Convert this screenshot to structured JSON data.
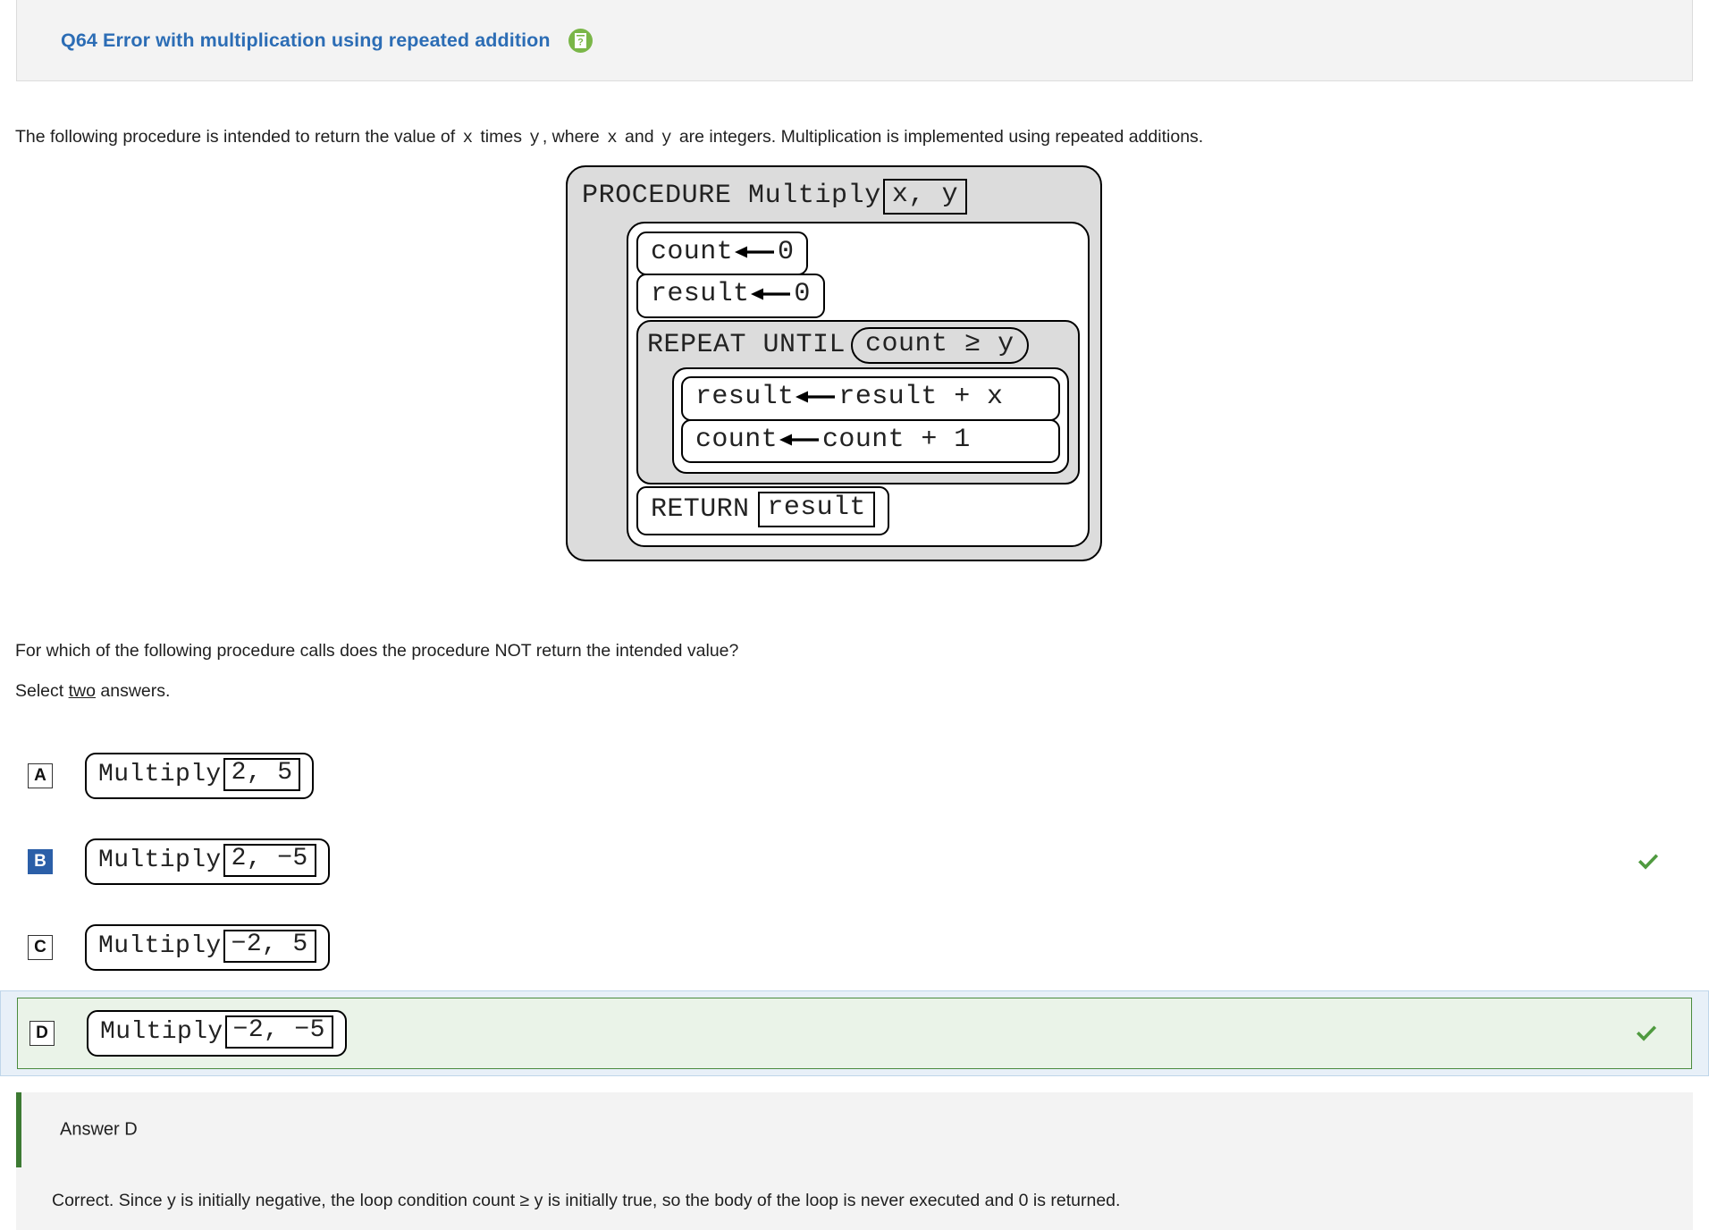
{
  "header": {
    "title": "Q64 Error with multiplication using repeated addition",
    "help_icon": "question-document-icon",
    "accent_color": "#2c6db5",
    "icon_bg_color": "#7ab648"
  },
  "intro": {
    "part1": "The following procedure is intended to return the value of",
    "var_x1": "x",
    "part2": "times",
    "var_y1": "y",
    "part3": ", where",
    "var_x2": "x",
    "part4": "and",
    "var_y2": "y",
    "part5": "are integers. Multiplication is implemented using repeated additions."
  },
  "pseudocode": {
    "procedure_keyword": "PROCEDURE Multiply",
    "parameters": "x, y",
    "statements": [
      {
        "target": "count",
        "arrow": "left-arrow-assign-icon",
        "value": "0"
      },
      {
        "target": "result",
        "arrow": "left-arrow-assign-icon",
        "value": "0"
      }
    ],
    "loop": {
      "keyword": "REPEAT UNTIL",
      "condition": "count ≥ y",
      "body": [
        {
          "target": "result",
          "arrow": "left-arrow-assign-icon",
          "value": "result + x"
        },
        {
          "target": "count",
          "arrow": "left-arrow-assign-icon",
          "value": "count + 1"
        }
      ]
    },
    "return_keyword": "RETURN",
    "return_value": "result"
  },
  "question": {
    "prompt": "For which of the following procedure calls does the procedure NOT return the intended value?",
    "select_prefix": "Select ",
    "select_emphasis": "two",
    "select_suffix": " answers."
  },
  "options": [
    {
      "letter": "A",
      "call": "Multiply",
      "args": "2, 5",
      "selected": false,
      "correct": false,
      "check_icon": ""
    },
    {
      "letter": "B",
      "call": "Multiply",
      "args": "2, −5",
      "selected": true,
      "correct": true,
      "check_icon": "check-mark-icon"
    },
    {
      "letter": "C",
      "call": "Multiply",
      "args": "−2, 5",
      "selected": false,
      "correct": false,
      "check_icon": ""
    },
    {
      "letter": "D",
      "call": "Multiply",
      "args": "−2, −5",
      "selected": false,
      "correct": true,
      "check_icon": "check-mark-icon"
    }
  ],
  "answer_panel": {
    "heading": "Answer D",
    "explanation": "Correct. Since y is initially negative, the loop condition count ≥ y is initially true, so the body of the loop is never executed and 0 is returned.",
    "accent_color": "#3d7a33"
  }
}
